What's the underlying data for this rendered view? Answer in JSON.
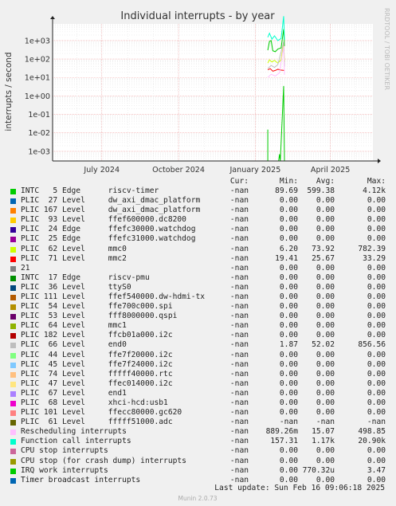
{
  "title": "Individual interrupts - by year",
  "side_label": "RRDTOOL / TOBI OETIKER",
  "footer": {
    "last_update": "Last update: Sun Feb 16 09:06:18 2025",
    "version": "Munin 2.0.73"
  },
  "columns": [
    "Cur:",
    "Min:",
    "Avg:",
    "Max:"
  ],
  "chart_data": {
    "type": "line",
    "title": "Individual interrupts - by year",
    "ylabel": "interrupts / second",
    "yscale": "log",
    "ylim": [
      0.0003,
      8000
    ],
    "y_ticks": [
      "1e-03",
      "1e-02",
      "1e-01",
      "1e+00",
      "1e+01",
      "1e+02",
      "1e+03"
    ],
    "x_ticks": [
      "July 2024",
      "October 2024",
      "January 2025",
      "April 2025"
    ],
    "x_range": [
      "2024-05-03",
      "2025-05-22"
    ],
    "x_tick_dates": [
      "2024-07-01",
      "2024-10-01",
      "2025-01-01",
      "2025-04-01"
    ],
    "grid": true,
    "series": [
      {
        "name": "INTC   5 Edge      riscv-timer",
        "color": "#00cc00",
        "cur": "-nan",
        "min": "89.69",
        "avg": "599.38",
        "max": "4.12k",
        "points": [
          [
            "2025-01-16",
            300
          ],
          [
            "2025-01-18",
            900
          ],
          [
            "2025-01-20",
            1000
          ],
          [
            "2025-01-22",
            280
          ],
          [
            "2025-01-25",
            250
          ],
          [
            "2025-01-28",
            350
          ],
          [
            "2025-02-01",
            400
          ],
          [
            "2025-02-04",
            4120
          ],
          [
            "2025-02-05",
            500
          ]
        ]
      },
      {
        "name": "PLIC  27 Level     dw_axi_dmac_platform",
        "color": "#0066b3",
        "cur": "-nan",
        "min": "0.00",
        "avg": "0.00",
        "max": "0.00",
        "points": []
      },
      {
        "name": "PLIC 167 Level     dw_axi_dmac_platform",
        "color": "#ff8000",
        "cur": "-nan",
        "min": "0.00",
        "avg": "0.00",
        "max": "0.00",
        "points": []
      },
      {
        "name": "PLIC  93 Level     ffef600000.dc8200",
        "color": "#ffcc00",
        "cur": "-nan",
        "min": "0.00",
        "avg": "0.00",
        "max": "0.00",
        "points": []
      },
      {
        "name": "PLIC  24 Edge      ffefc30000.watchdog",
        "color": "#330099",
        "cur": "-nan",
        "min": "0.00",
        "avg": "0.00",
        "max": "0.00",
        "points": []
      },
      {
        "name": "PLIC  25 Edge      ffefc31000.watchdog",
        "color": "#990099",
        "cur": "-nan",
        "min": "0.00",
        "avg": "0.00",
        "max": "0.00",
        "points": []
      },
      {
        "name": "PLIC  62 Level     mmc0",
        "color": "#ccff00",
        "cur": "-nan",
        "min": "6.20",
        "avg": "73.92",
        "max": "782.39",
        "points": [
          [
            "2025-01-16",
            60
          ],
          [
            "2025-01-18",
            90
          ],
          [
            "2025-01-21",
            70
          ],
          [
            "2025-01-24",
            85
          ],
          [
            "2025-01-28",
            60
          ],
          [
            "2025-02-01",
            90
          ],
          [
            "2025-02-04",
            782
          ],
          [
            "2025-02-05",
            70
          ]
        ]
      },
      {
        "name": "PLIC  71 Level     mmc2",
        "color": "#ff0000",
        "cur": "-nan",
        "min": "19.41",
        "avg": "25.67",
        "max": "33.29",
        "points": [
          [
            "2025-01-16",
            26
          ],
          [
            "2025-01-19",
            30
          ],
          [
            "2025-01-22",
            22
          ],
          [
            "2025-01-25",
            24
          ],
          [
            "2025-01-28",
            28
          ],
          [
            "2025-02-01",
            25
          ],
          [
            "2025-02-05",
            24
          ]
        ]
      },
      {
        "name": "21",
        "color": "#808080",
        "cur": "-nan",
        "min": "0.00",
        "avg": "0.00",
        "max": "0.00",
        "points": []
      },
      {
        "name": "INTC  17 Edge      riscv-pmu",
        "color": "#008f00",
        "cur": "-nan",
        "min": "0.00",
        "avg": "0.00",
        "max": "0.00",
        "points": []
      },
      {
        "name": "PLIC  36 Level     ttyS0",
        "color": "#00487d",
        "cur": "-nan",
        "min": "0.00",
        "avg": "0.00",
        "max": "0.00",
        "points": []
      },
      {
        "name": "PLIC 111 Level     ffef540000.dw-hdmi-tx",
        "color": "#b35a00",
        "cur": "-nan",
        "min": "0.00",
        "avg": "0.00",
        "max": "0.00",
        "points": []
      },
      {
        "name": "PLIC  54 Level     ffe700c000.spi",
        "color": "#b38f00",
        "cur": "-nan",
        "min": "0.00",
        "avg": "0.00",
        "max": "0.00",
        "points": []
      },
      {
        "name": "PLIC  53 Level     fff8000000.qspi",
        "color": "#6b006b",
        "cur": "-nan",
        "min": "0.00",
        "avg": "0.00",
        "max": "0.00",
        "points": []
      },
      {
        "name": "PLIC  64 Level     mmc1",
        "color": "#8fb300",
        "cur": "-nan",
        "min": "0.00",
        "avg": "0.00",
        "max": "0.00",
        "points": []
      },
      {
        "name": "PLIC 182 Level     ffcb01a000.i2c",
        "color": "#b30000",
        "cur": "-nan",
        "min": "0.00",
        "avg": "0.00",
        "max": "0.00",
        "points": []
      },
      {
        "name": "PLIC  66 Level     end0",
        "color": "#bebebe",
        "cur": "-nan",
        "min": "1.87",
        "avg": "52.02",
        "max": "856.56",
        "points": [
          [
            "2025-01-16",
            30
          ],
          [
            "2025-01-20",
            45
          ],
          [
            "2025-01-24",
            35
          ],
          [
            "2025-01-28",
            50
          ],
          [
            "2025-02-04",
            856
          ],
          [
            "2025-02-05",
            40
          ]
        ]
      },
      {
        "name": "PLIC  44 Level     ffe7f20000.i2c",
        "color": "#80ff80",
        "cur": "-nan",
        "min": "0.00",
        "avg": "0.00",
        "max": "0.00",
        "points": []
      },
      {
        "name": "PLIC  45 Level     ffe7f24000.i2c",
        "color": "#80c9ff",
        "cur": "-nan",
        "min": "0.00",
        "avg": "0.00",
        "max": "0.00",
        "points": []
      },
      {
        "name": "PLIC  74 Level     fffff40000.rtc",
        "color": "#ffc080",
        "cur": "-nan",
        "min": "0.00",
        "avg": "0.00",
        "max": "0.00",
        "points": []
      },
      {
        "name": "PLIC  47 Level     ffec014000.i2c",
        "color": "#ffe680",
        "cur": "-nan",
        "min": "0.00",
        "avg": "0.00",
        "max": "0.00",
        "points": []
      },
      {
        "name": "PLIC  67 Level     end1",
        "color": "#aa80ff",
        "cur": "-nan",
        "min": "0.00",
        "avg": "0.00",
        "max": "0.00",
        "points": []
      },
      {
        "name": "PLIC  68 Level     xhci-hcd:usb1",
        "color": "#ee00cc",
        "cur": "-nan",
        "min": "0.00",
        "avg": "0.00",
        "max": "0.00",
        "points": []
      },
      {
        "name": "PLIC 101 Level     ffecc80000.gc620",
        "color": "#ff8080",
        "cur": "-nan",
        "min": "0.00",
        "avg": "0.00",
        "max": "0.00",
        "points": []
      },
      {
        "name": "PLIC  61 Level     fffff51000.adc",
        "color": "#666600",
        "cur": "-nan",
        "min": "-nan",
        "avg": "-nan",
        "max": "-nan",
        "points": []
      },
      {
        "name": "Rescheduling interrupts",
        "color": "#ffbfff",
        "cur": "-nan",
        "min": "889.26m",
        "avg": "15.07",
        "max": "498.85",
        "points": [
          [
            "2025-01-16",
            10
          ],
          [
            "2025-01-20",
            15
          ],
          [
            "2025-01-25",
            12
          ],
          [
            "2025-01-30",
            18
          ],
          [
            "2025-02-04",
            498
          ],
          [
            "2025-02-05",
            14
          ]
        ]
      },
      {
        "name": "Function call interrupts",
        "color": "#00ffcc",
        "cur": "-nan",
        "min": "157.31",
        "avg": "1.17k",
        "max": "20.90k",
        "points": [
          [
            "2025-01-16",
            1500
          ],
          [
            "2025-01-18",
            2500
          ],
          [
            "2025-01-21",
            1200
          ],
          [
            "2025-01-24",
            1800
          ],
          [
            "2025-01-28",
            1000
          ],
          [
            "2025-02-01",
            1300
          ],
          [
            "2025-02-04",
            20900
          ],
          [
            "2025-02-05",
            1100
          ]
        ]
      },
      {
        "name": "CPU stop interrupts",
        "color": "#cc6699",
        "cur": "-nan",
        "min": "0.00",
        "avg": "0.00",
        "max": "0.00",
        "points": []
      },
      {
        "name": "CPU stop (for crash dump) interrupts",
        "color": "#999900",
        "cur": "-nan",
        "min": "0.00",
        "avg": "0.00",
        "max": "0.00",
        "points": []
      },
      {
        "name": "IRQ work interrupts",
        "color": "#00cc00",
        "cur": "-nan",
        "min": "0.00",
        "avg": "770.32u",
        "max": "3.47",
        "points": [
          [
            "2025-01-16",
            0.015
          ],
          [
            "2025-01-16",
            0.0003
          ],
          [
            "2025-01-20",
            0.0003
          ],
          [
            "2025-01-29",
            0.0003
          ],
          [
            "2025-01-30",
            0.0007
          ],
          [
            "2025-01-31",
            0.0003
          ],
          [
            "2025-02-04",
            3.47
          ],
          [
            "2025-02-05",
            0.0003
          ]
        ]
      },
      {
        "name": "Timer broadcast interrupts",
        "color": "#0066b3",
        "cur": "-nan",
        "min": "0.00",
        "avg": "0.00",
        "max": "0.00",
        "points": []
      }
    ]
  }
}
